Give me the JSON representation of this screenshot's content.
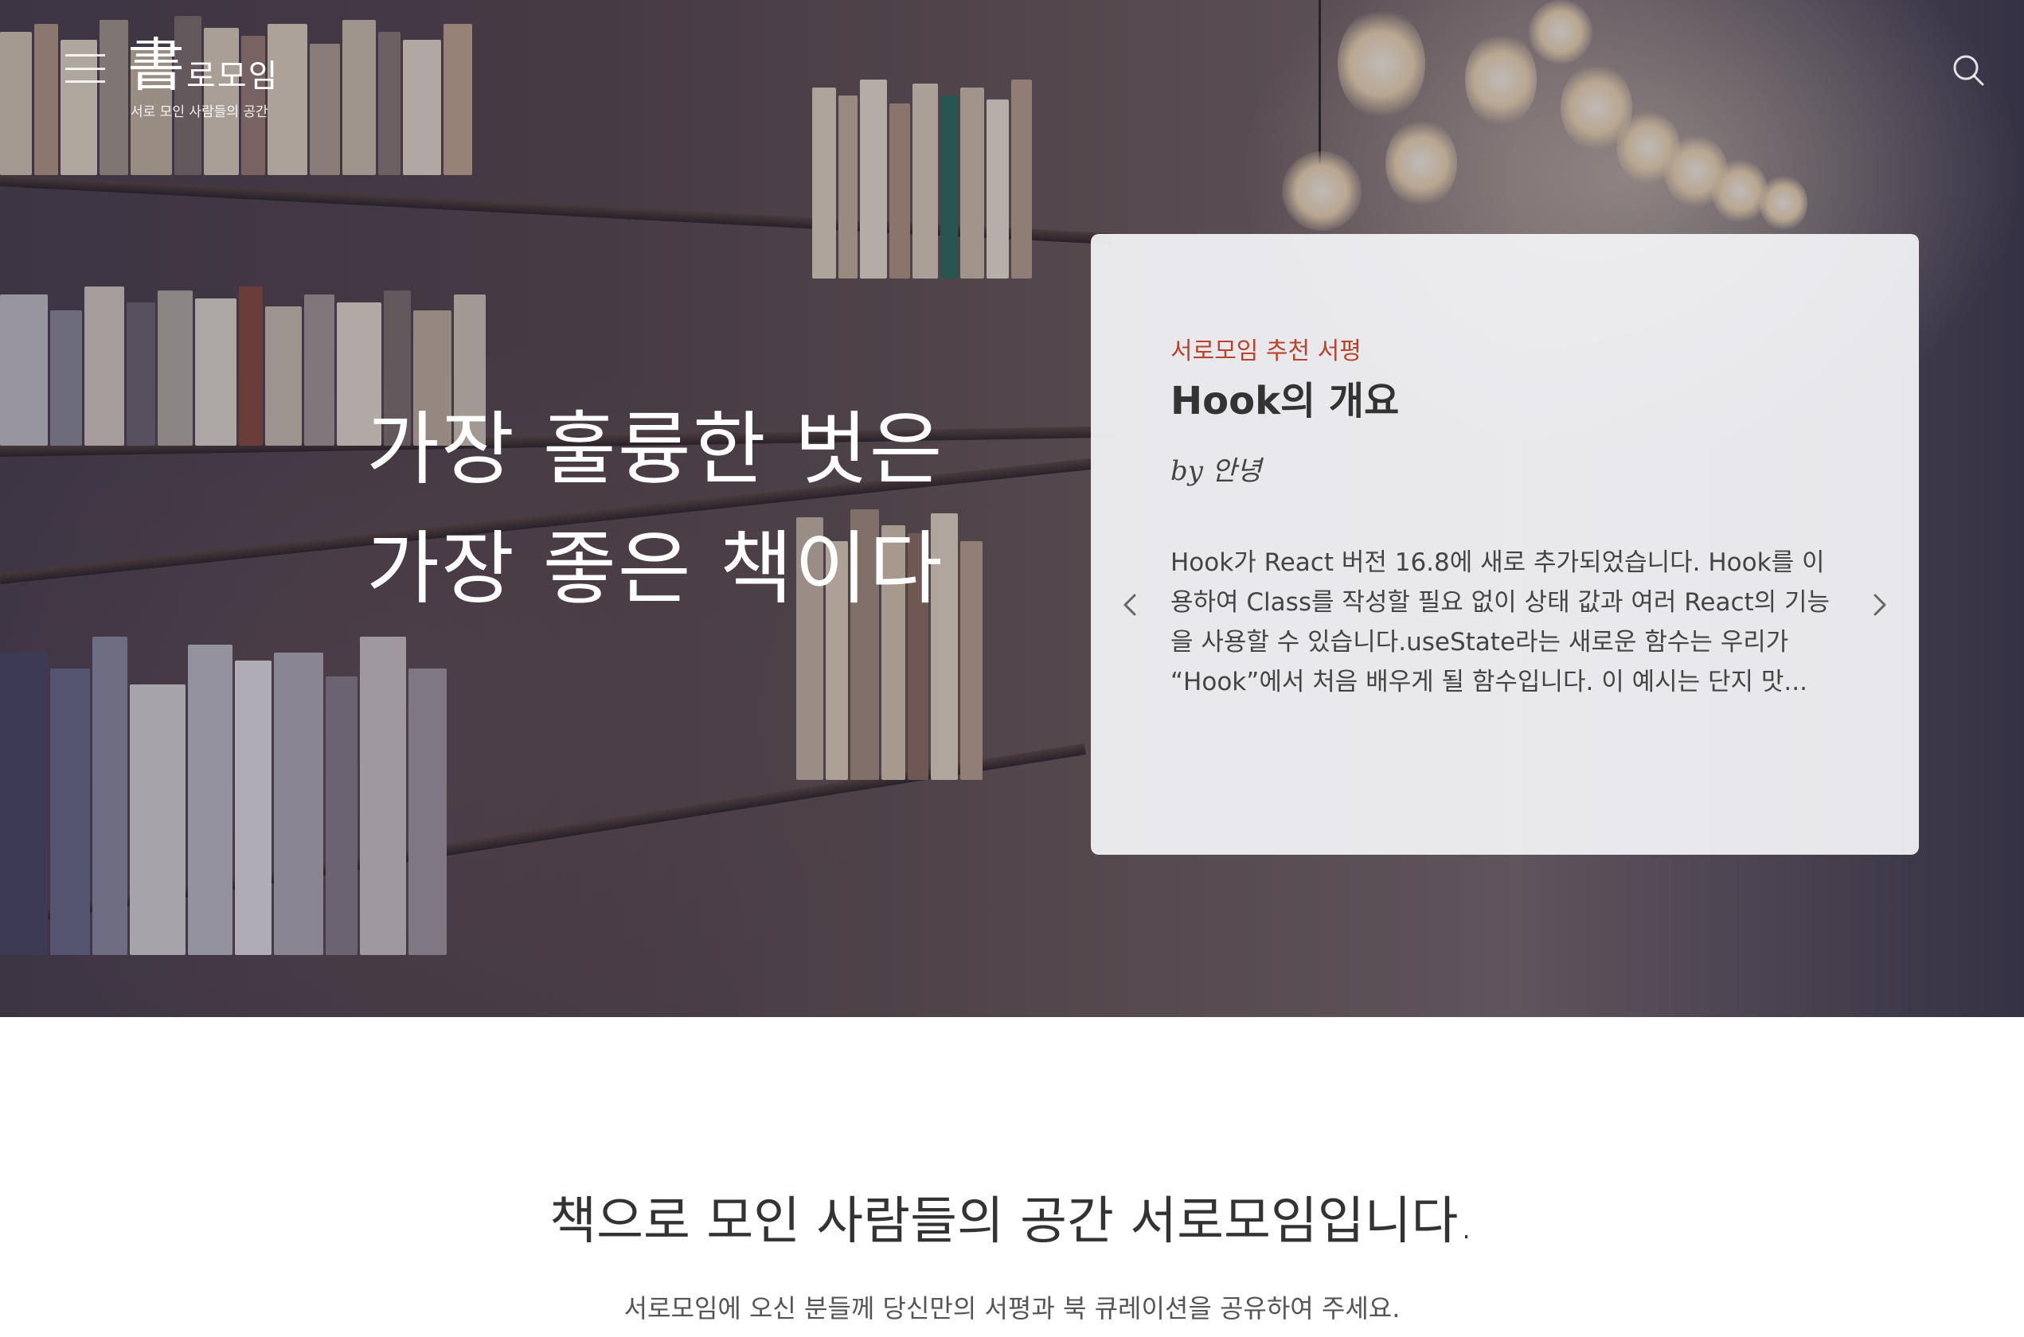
{
  "header": {
    "logo_hanja": "書",
    "logo_text": "로모임",
    "logo_subtitle": "서로 모인 사람들의 공간",
    "menu_icon": "hamburger-menu-icon",
    "search_icon": "search-icon"
  },
  "hero": {
    "quote_line1": "가장 훌륭한 벗은",
    "quote_line2": "가장 좋은 책이다"
  },
  "review_card": {
    "label": "서로모임 추천 서평",
    "title": "Hook의 개요",
    "author": "by 안녕",
    "excerpt": "Hook가 React 버전 16.8에 새로 추가되었습니다. Hook를 이용하여 Class를 작성할 필요 없이 상태 값과 여러 React의 기능을 사용할 수 있습니다.useState라는 새로운 함수는 우리가 “Hook”에서 처음 배우게 될 함수입니다. 이 예시는 단지 맛...",
    "prev_icon": "chevron-left-icon",
    "next_icon": "chevron-right-icon",
    "label_color": "#b7442c"
  },
  "intro": {
    "title": "책으로 모인 사람들의 공간 서로모임입니다.",
    "subtitle": "서로모임에 오신 분들께 당신만의 서평과 북 큐레이션을 공유하여 주세요."
  }
}
